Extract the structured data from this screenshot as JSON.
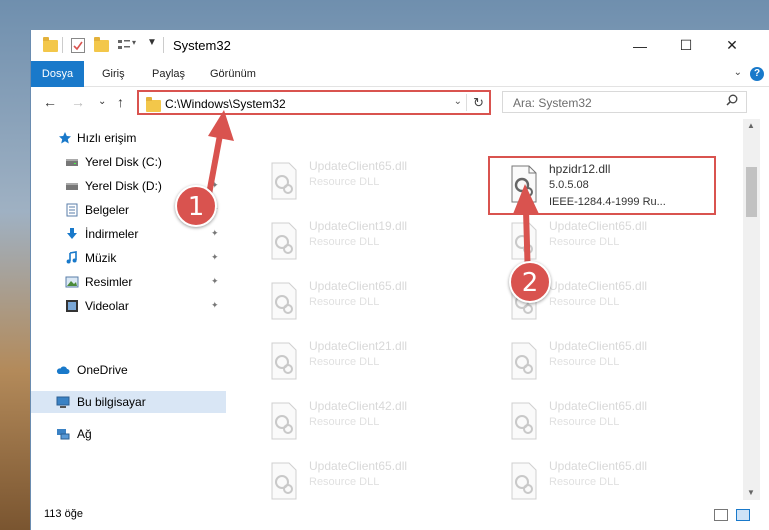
{
  "window": {
    "title": "System32",
    "minimize_glyph": "—",
    "maximize_glyph": "☐",
    "close_glyph": "✕"
  },
  "ribbon": {
    "tabs": [
      "Dosya",
      "Giriş",
      "Paylaş",
      "Görünüm"
    ],
    "expand_glyph": "⌄",
    "help_glyph": "?"
  },
  "nav": {
    "back_glyph": "←",
    "forward_glyph": "→",
    "recent_glyph": "⌄",
    "up_glyph": "↑",
    "address": "C:\\Windows\\System32",
    "address_dropdown_glyph": "⌄",
    "refresh_glyph": "↻",
    "search_placeholder": "Ara: System32"
  },
  "sidebar": {
    "items": [
      {
        "label": "Hızlı erişim",
        "icon": "star-icon",
        "pinned": false
      },
      {
        "label": "Yerel Disk (C:)",
        "icon": "drive-icon",
        "pinned": true
      },
      {
        "label": "Yerel Disk (D:)",
        "icon": "drive-icon",
        "pinned": true
      },
      {
        "label": "Belgeler",
        "icon": "documents-icon",
        "pinned": true
      },
      {
        "label": "İndirmeler",
        "icon": "download-icon",
        "pinned": true
      },
      {
        "label": "Müzik",
        "icon": "music-icon",
        "pinned": true
      },
      {
        "label": "Resimler",
        "icon": "pictures-icon",
        "pinned": true
      },
      {
        "label": "Videolar",
        "icon": "video-icon",
        "pinned": true
      },
      {
        "label": "OneDrive",
        "icon": "cloud-icon",
        "pinned": false
      },
      {
        "label": "Bu bilgisayar",
        "icon": "computer-icon",
        "pinned": false,
        "selected": true
      },
      {
        "label": "Ağ",
        "icon": "network-icon",
        "pinned": false
      }
    ],
    "pin_glyph": "📌"
  },
  "files": {
    "left_column": [
      {
        "name": "UpdateClient65.dll",
        "type": "Resource DLL"
      },
      {
        "name": "UpdateClient19.dll",
        "type": "Resource DLL"
      },
      {
        "name": "UpdateClient65.dll",
        "type": "Resource DLL"
      },
      {
        "name": "UpdateClient21.dll",
        "type": "Resource DLL"
      },
      {
        "name": "UpdateClient42.dll",
        "type": "Resource DLL"
      },
      {
        "name": "UpdateClient65.dll",
        "type": "Resource DLL"
      }
    ],
    "right_column": [
      {
        "name": "hpzidr12.dll",
        "version": "5.0.5.08",
        "description": "IEEE-1284.4-1999 Ru...",
        "highlighted": true
      },
      {
        "name": "UpdateClient65.dll",
        "type": "Resource DLL"
      },
      {
        "name": "UpdateClient65.dll",
        "type": "Resource DLL"
      },
      {
        "name": "UpdateClient65.dll",
        "type": "Resource DLL"
      },
      {
        "name": "UpdateClient65.dll",
        "type": "Resource DLL"
      },
      {
        "name": "UpdateClient65.dll",
        "type": "Resource DLL"
      }
    ]
  },
  "status": {
    "item_count": "113 öğe"
  },
  "annotations": {
    "step1": "1",
    "step2": "2",
    "color": "#d9534f"
  },
  "colors": {
    "accent": "#1979ca",
    "selection": "#d9e6f5"
  }
}
